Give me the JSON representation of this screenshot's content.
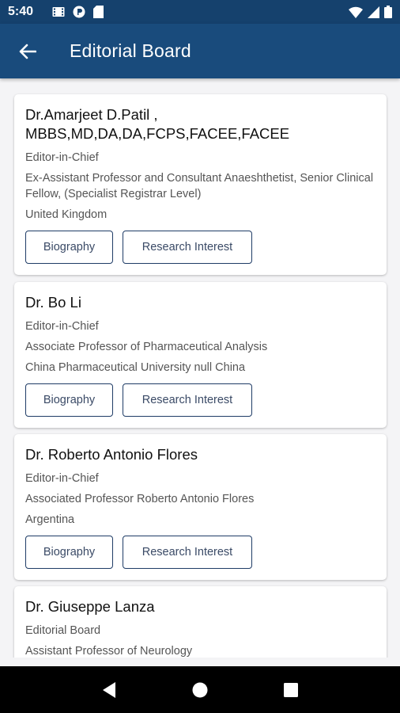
{
  "status_bar": {
    "time": "5:40"
  },
  "app_bar": {
    "title": "Editorial Board"
  },
  "cards": [
    {
      "name": "Dr.Amarjeet D.Patil , MBBS,MD,DA,DA,FCPS,FACEE,FACEE",
      "role": "Editor-in-Chief",
      "affiliation": "Ex-Assistant Professor and Consultant Anaeshthetist, Senior Clinical Fellow, (Specialist Registrar Level)",
      "location": "United Kingdom",
      "biography_label": "Biography",
      "research_label": "Research Interest"
    },
    {
      "name": "Dr. Bo Li",
      "role": "Editor-in-Chief",
      "affiliation": "Associate Professor of Pharmaceutical Analysis",
      "location": "China Pharmaceutical University null China",
      "biography_label": "Biography",
      "research_label": "Research Interest"
    },
    {
      "name": "Dr. Roberto Antonio Flores",
      "role": "Editor-in-Chief",
      "affiliation": "Associated Professor Roberto Antonio Flores",
      "location": "Argentina",
      "biography_label": "Biography",
      "research_label": "Research Interest"
    },
    {
      "name": "Dr. Giuseppe Lanza",
      "role": "Editorial Board",
      "affiliation": "Assistant Professor of Neurology"
    }
  ]
}
